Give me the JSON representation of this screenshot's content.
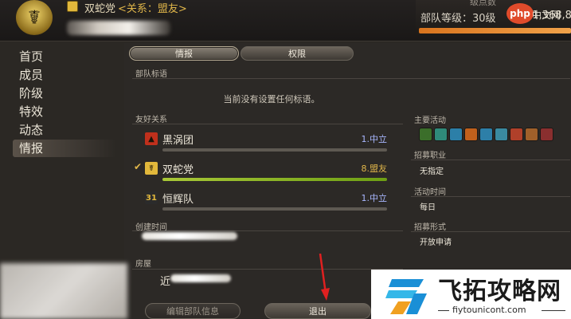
{
  "header": {
    "fc_name": "双蛇党",
    "relation": "<关系：盟友>",
    "rank_label": "部队等级：30级",
    "rank_value": "11,368,8",
    "rank_top_label": "级点数",
    "watermark_site": "php",
    "watermark_site_text": "中文网"
  },
  "nav": {
    "items": [
      "首页",
      "成员",
      "阶级",
      "特效",
      "动态",
      "情报"
    ],
    "active_index": 5
  },
  "tabs": [
    {
      "label": "情报",
      "active": true
    },
    {
      "label": "权限",
      "active": false
    }
  ],
  "info": {
    "slogan_label": "部队标语",
    "slogan_text": "当前没有设置任何标语。",
    "relations_label": "友好关系",
    "relations": [
      {
        "name": "黑涡团",
        "status": "1.中立",
        "status_color": "#a9b7ff",
        "icon_color": "#c0301c",
        "selected": false,
        "bar": "neutral"
      },
      {
        "name": "双蛇党",
        "status": "8.盟友",
        "status_color": "#e0b64a",
        "icon_color": "#e2b83b",
        "selected": true,
        "bar": "green"
      },
      {
        "name": "恒辉队",
        "status": "1.中立",
        "status_color": "#a9b7ff",
        "icon_color": "#2b2b2b",
        "selected": false,
        "bar": "neutral"
      }
    ],
    "created_label": "创建时间",
    "housing_label": "房屋",
    "housing_value_partial": "近"
  },
  "right": {
    "activity_label": "主要活动",
    "activity_icons": [
      "role-play-icon",
      "leveling-icon",
      "casual-icon",
      "hardcore-icon",
      "dungeon-icon",
      "guildhest-icon",
      "trial-icon",
      "raid-icon",
      "pvp-icon"
    ],
    "activity_colors": [
      "#3b6e2a",
      "#2f8a7a",
      "#2c7fa8",
      "#c0601c",
      "#2d7fa8",
      "#3a8aa0",
      "#b0402a",
      "#a0602a",
      "#8a2f2f"
    ],
    "recruit_label": "招募职业",
    "recruit_value": "无指定",
    "time_label": "活动时间",
    "time_value": "每日",
    "form_label": "招募形式",
    "form_value": "开放申请"
  },
  "buttons": {
    "edit": "编辑部队信息",
    "exit": "退出"
  },
  "watermark": {
    "title": "飞拓攻略网",
    "url": "fiytounicont.com"
  }
}
